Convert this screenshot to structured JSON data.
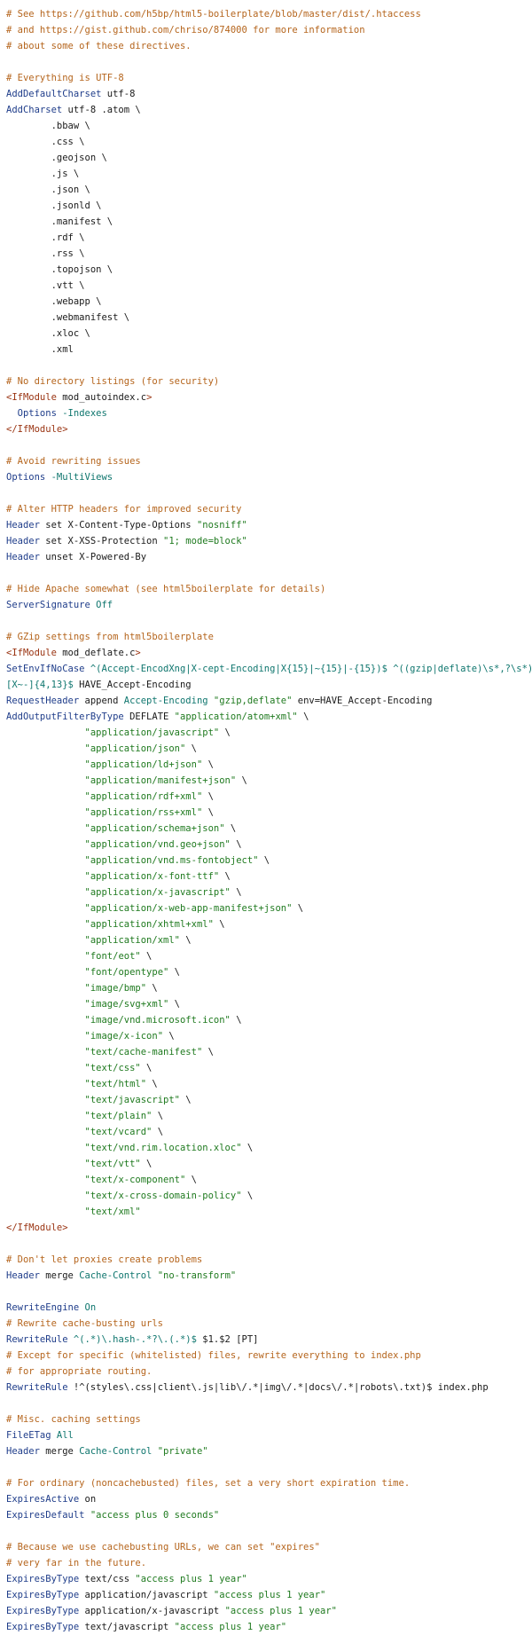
{
  "lines": [
    [
      {
        "t": "comment",
        "s": "# See https://github.com/h5bp/html5-boilerplate/blob/master/dist/.htaccess"
      }
    ],
    [
      {
        "t": "comment",
        "s": "# and https://gist.github.com/chriso/874000 for more information"
      }
    ],
    [
      {
        "t": "comment",
        "s": "# about some of these directives."
      }
    ],
    [],
    [
      {
        "t": "comment",
        "s": "# Everything is UTF-8"
      }
    ],
    [
      {
        "t": "directive",
        "s": "AddDefaultCharset"
      },
      {
        "t": "plain",
        "s": " utf-8"
      }
    ],
    [
      {
        "t": "directive",
        "s": "AddCharset"
      },
      {
        "t": "plain",
        "s": " utf-8 .atom \\"
      }
    ],
    [
      {
        "t": "plain",
        "s": "        .bbaw \\"
      }
    ],
    [
      {
        "t": "plain",
        "s": "        .css \\"
      }
    ],
    [
      {
        "t": "plain",
        "s": "        .geojson \\"
      }
    ],
    [
      {
        "t": "plain",
        "s": "        .js \\"
      }
    ],
    [
      {
        "t": "plain",
        "s": "        .json \\"
      }
    ],
    [
      {
        "t": "plain",
        "s": "        .jsonld \\"
      }
    ],
    [
      {
        "t": "plain",
        "s": "        .manifest \\"
      }
    ],
    [
      {
        "t": "plain",
        "s": "        .rdf \\"
      }
    ],
    [
      {
        "t": "plain",
        "s": "        .rss \\"
      }
    ],
    [
      {
        "t": "plain",
        "s": "        .topojson \\"
      }
    ],
    [
      {
        "t": "plain",
        "s": "        .vtt \\"
      }
    ],
    [
      {
        "t": "plain",
        "s": "        .webapp \\"
      }
    ],
    [
      {
        "t": "plain",
        "s": "        .webmanifest \\"
      }
    ],
    [
      {
        "t": "plain",
        "s": "        .xloc \\"
      }
    ],
    [
      {
        "t": "plain",
        "s": "        .xml"
      }
    ],
    [],
    [
      {
        "t": "comment",
        "s": "# No directory listings (for security)"
      }
    ],
    [
      {
        "t": "tag",
        "s": "<IfModule"
      },
      {
        "t": "plain",
        "s": " mod_autoindex.c"
      },
      {
        "t": "tag",
        "s": ">"
      }
    ],
    [
      {
        "t": "directive",
        "s": "  Options"
      },
      {
        "t": "plain",
        "s": " "
      },
      {
        "t": "value",
        "s": "-Indexes"
      }
    ],
    [
      {
        "t": "tag",
        "s": "</IfModule>"
      }
    ],
    [],
    [
      {
        "t": "comment",
        "s": "# Avoid rewriting issues"
      }
    ],
    [
      {
        "t": "directive",
        "s": "Options"
      },
      {
        "t": "plain",
        "s": " "
      },
      {
        "t": "value",
        "s": "-MultiViews"
      }
    ],
    [],
    [
      {
        "t": "comment",
        "s": "# Alter HTTP headers for improved security"
      }
    ],
    [
      {
        "t": "directive",
        "s": "Header"
      },
      {
        "t": "plain",
        "s": " set X-Content-Type-Options "
      },
      {
        "t": "string",
        "s": "\"nosniff\""
      }
    ],
    [
      {
        "t": "directive",
        "s": "Header"
      },
      {
        "t": "plain",
        "s": " set X-XSS-Protection "
      },
      {
        "t": "string",
        "s": "\"1; mode=block\""
      }
    ],
    [
      {
        "t": "directive",
        "s": "Header"
      },
      {
        "t": "plain",
        "s": " unset X-Powered-By"
      }
    ],
    [],
    [
      {
        "t": "comment",
        "s": "# Hide Apache somewhat (see html5boilerplate for details)"
      }
    ],
    [
      {
        "t": "directive",
        "s": "ServerSignature"
      },
      {
        "t": "plain",
        "s": " "
      },
      {
        "t": "value",
        "s": "Off"
      }
    ],
    [],
    [
      {
        "t": "comment",
        "s": "# GZip settings from html5boilerplate"
      }
    ],
    [
      {
        "t": "tag",
        "s": "<IfModule"
      },
      {
        "t": "plain",
        "s": " mod_deflate.c"
      },
      {
        "t": "tag",
        "s": ">"
      }
    ],
    [
      {
        "t": "directive",
        "s": "SetEnvIfNoCase"
      },
      {
        "t": "plain",
        "s": " "
      },
      {
        "t": "value",
        "s": "^(Accept-EncodXng|X-cept-Encoding|X{15}|~{15}|-{15})$"
      },
      {
        "t": "plain",
        "s": " "
      },
      {
        "t": "value",
        "s": "^((gzip|deflate)\\s*,?\\s*)+|"
      }
    ],
    [
      {
        "t": "value",
        "s": "[X~-]{4,13}$"
      },
      {
        "t": "plain",
        "s": " HAVE_Accept-Encoding"
      }
    ],
    [
      {
        "t": "directive",
        "s": "RequestHeader"
      },
      {
        "t": "plain",
        "s": " append "
      },
      {
        "t": "value",
        "s": "Accept-Encoding"
      },
      {
        "t": "plain",
        "s": " "
      },
      {
        "t": "string",
        "s": "\"gzip,deflate\""
      },
      {
        "t": "plain",
        "s": " env=HAVE_Accept-Encoding"
      }
    ],
    [
      {
        "t": "directive",
        "s": "AddOutputFilterByType"
      },
      {
        "t": "plain",
        "s": " DEFLATE "
      },
      {
        "t": "string",
        "s": "\"application/atom+xml\""
      },
      {
        "t": "plain",
        "s": " \\"
      }
    ],
    [
      {
        "t": "plain",
        "s": "              "
      },
      {
        "t": "string",
        "s": "\"application/javascript\""
      },
      {
        "t": "plain",
        "s": " \\"
      }
    ],
    [
      {
        "t": "plain",
        "s": "              "
      },
      {
        "t": "string",
        "s": "\"application/json\""
      },
      {
        "t": "plain",
        "s": " \\"
      }
    ],
    [
      {
        "t": "plain",
        "s": "              "
      },
      {
        "t": "string",
        "s": "\"application/ld+json\""
      },
      {
        "t": "plain",
        "s": " \\"
      }
    ],
    [
      {
        "t": "plain",
        "s": "              "
      },
      {
        "t": "string",
        "s": "\"application/manifest+json\""
      },
      {
        "t": "plain",
        "s": " \\"
      }
    ],
    [
      {
        "t": "plain",
        "s": "              "
      },
      {
        "t": "string",
        "s": "\"application/rdf+xml\""
      },
      {
        "t": "plain",
        "s": " \\"
      }
    ],
    [
      {
        "t": "plain",
        "s": "              "
      },
      {
        "t": "string",
        "s": "\"application/rss+xml\""
      },
      {
        "t": "plain",
        "s": " \\"
      }
    ],
    [
      {
        "t": "plain",
        "s": "              "
      },
      {
        "t": "string",
        "s": "\"application/schema+json\""
      },
      {
        "t": "plain",
        "s": " \\"
      }
    ],
    [
      {
        "t": "plain",
        "s": "              "
      },
      {
        "t": "string",
        "s": "\"application/vnd.geo+json\""
      },
      {
        "t": "plain",
        "s": " \\"
      }
    ],
    [
      {
        "t": "plain",
        "s": "              "
      },
      {
        "t": "string",
        "s": "\"application/vnd.ms-fontobject\""
      },
      {
        "t": "plain",
        "s": " \\"
      }
    ],
    [
      {
        "t": "plain",
        "s": "              "
      },
      {
        "t": "string",
        "s": "\"application/x-font-ttf\""
      },
      {
        "t": "plain",
        "s": " \\"
      }
    ],
    [
      {
        "t": "plain",
        "s": "              "
      },
      {
        "t": "string",
        "s": "\"application/x-javascript\""
      },
      {
        "t": "plain",
        "s": " \\"
      }
    ],
    [
      {
        "t": "plain",
        "s": "              "
      },
      {
        "t": "string",
        "s": "\"application/x-web-app-manifest+json\""
      },
      {
        "t": "plain",
        "s": " \\"
      }
    ],
    [
      {
        "t": "plain",
        "s": "              "
      },
      {
        "t": "string",
        "s": "\"application/xhtml+xml\""
      },
      {
        "t": "plain",
        "s": " \\"
      }
    ],
    [
      {
        "t": "plain",
        "s": "              "
      },
      {
        "t": "string",
        "s": "\"application/xml\""
      },
      {
        "t": "plain",
        "s": " \\"
      }
    ],
    [
      {
        "t": "plain",
        "s": "              "
      },
      {
        "t": "string",
        "s": "\"font/eot\""
      },
      {
        "t": "plain",
        "s": " \\"
      }
    ],
    [
      {
        "t": "plain",
        "s": "              "
      },
      {
        "t": "string",
        "s": "\"font/opentype\""
      },
      {
        "t": "plain",
        "s": " \\"
      }
    ],
    [
      {
        "t": "plain",
        "s": "              "
      },
      {
        "t": "string",
        "s": "\"image/bmp\""
      },
      {
        "t": "plain",
        "s": " \\"
      }
    ],
    [
      {
        "t": "plain",
        "s": "              "
      },
      {
        "t": "string",
        "s": "\"image/svg+xml\""
      },
      {
        "t": "plain",
        "s": " \\"
      }
    ],
    [
      {
        "t": "plain",
        "s": "              "
      },
      {
        "t": "string",
        "s": "\"image/vnd.microsoft.icon\""
      },
      {
        "t": "plain",
        "s": " \\"
      }
    ],
    [
      {
        "t": "plain",
        "s": "              "
      },
      {
        "t": "string",
        "s": "\"image/x-icon\""
      },
      {
        "t": "plain",
        "s": " \\"
      }
    ],
    [
      {
        "t": "plain",
        "s": "              "
      },
      {
        "t": "string",
        "s": "\"text/cache-manifest\""
      },
      {
        "t": "plain",
        "s": " \\"
      }
    ],
    [
      {
        "t": "plain",
        "s": "              "
      },
      {
        "t": "string",
        "s": "\"text/css\""
      },
      {
        "t": "plain",
        "s": " \\"
      }
    ],
    [
      {
        "t": "plain",
        "s": "              "
      },
      {
        "t": "string",
        "s": "\"text/html\""
      },
      {
        "t": "plain",
        "s": " \\"
      }
    ],
    [
      {
        "t": "plain",
        "s": "              "
      },
      {
        "t": "string",
        "s": "\"text/javascript\""
      },
      {
        "t": "plain",
        "s": " \\"
      }
    ],
    [
      {
        "t": "plain",
        "s": "              "
      },
      {
        "t": "string",
        "s": "\"text/plain\""
      },
      {
        "t": "plain",
        "s": " \\"
      }
    ],
    [
      {
        "t": "plain",
        "s": "              "
      },
      {
        "t": "string",
        "s": "\"text/vcard\""
      },
      {
        "t": "plain",
        "s": " \\"
      }
    ],
    [
      {
        "t": "plain",
        "s": "              "
      },
      {
        "t": "string",
        "s": "\"text/vnd.rim.location.xloc\""
      },
      {
        "t": "plain",
        "s": " \\"
      }
    ],
    [
      {
        "t": "plain",
        "s": "              "
      },
      {
        "t": "string",
        "s": "\"text/vtt\""
      },
      {
        "t": "plain",
        "s": " \\"
      }
    ],
    [
      {
        "t": "plain",
        "s": "              "
      },
      {
        "t": "string",
        "s": "\"text/x-component\""
      },
      {
        "t": "plain",
        "s": " \\"
      }
    ],
    [
      {
        "t": "plain",
        "s": "              "
      },
      {
        "t": "string",
        "s": "\"text/x-cross-domain-policy\""
      },
      {
        "t": "plain",
        "s": " \\"
      }
    ],
    [
      {
        "t": "plain",
        "s": "              "
      },
      {
        "t": "string",
        "s": "\"text/xml\""
      }
    ],
    [
      {
        "t": "tag",
        "s": "</IfModule>"
      }
    ],
    [],
    [
      {
        "t": "comment",
        "s": "# Don't let proxies create problems"
      }
    ],
    [
      {
        "t": "directive",
        "s": "Header"
      },
      {
        "t": "plain",
        "s": " merge "
      },
      {
        "t": "value",
        "s": "Cache-Control"
      },
      {
        "t": "plain",
        "s": " "
      },
      {
        "t": "string",
        "s": "\"no-transform\""
      }
    ],
    [],
    [
      {
        "t": "directive",
        "s": "RewriteEngine"
      },
      {
        "t": "plain",
        "s": " "
      },
      {
        "t": "value",
        "s": "On"
      }
    ],
    [
      {
        "t": "comment",
        "s": "# Rewrite cache-busting urls"
      }
    ],
    [
      {
        "t": "directive",
        "s": "RewriteRule"
      },
      {
        "t": "plain",
        "s": " "
      },
      {
        "t": "value",
        "s": "^(.*)\\.hash-.*?\\.(.*)$"
      },
      {
        "t": "plain",
        "s": " $1.$2 [PT]"
      }
    ],
    [
      {
        "t": "comment",
        "s": "# Except for specific (whitelisted) files, rewrite everything to index.php"
      }
    ],
    [
      {
        "t": "comment",
        "s": "# for appropriate routing."
      }
    ],
    [
      {
        "t": "directive",
        "s": "RewriteRule"
      },
      {
        "t": "plain",
        "s": " !^(styles\\.css|client\\.js|lib\\/.*|img\\/.*|docs\\/.*|robots\\.txt)$ index.php"
      }
    ],
    [],
    [
      {
        "t": "comment",
        "s": "# Misc. caching settings"
      }
    ],
    [
      {
        "t": "directive",
        "s": "FileETag"
      },
      {
        "t": "plain",
        "s": " "
      },
      {
        "t": "value",
        "s": "All"
      }
    ],
    [
      {
        "t": "directive",
        "s": "Header"
      },
      {
        "t": "plain",
        "s": " merge "
      },
      {
        "t": "value",
        "s": "Cache-Control"
      },
      {
        "t": "plain",
        "s": " "
      },
      {
        "t": "string",
        "s": "\"private\""
      }
    ],
    [],
    [
      {
        "t": "comment",
        "s": "# For ordinary (noncachebusted) files, set a very short expiration time."
      }
    ],
    [
      {
        "t": "directive",
        "s": "ExpiresActive"
      },
      {
        "t": "plain",
        "s": " on"
      }
    ],
    [
      {
        "t": "directive",
        "s": "ExpiresDefault"
      },
      {
        "t": "plain",
        "s": " "
      },
      {
        "t": "string",
        "s": "\"access plus 0 seconds\""
      }
    ],
    [],
    [
      {
        "t": "comment",
        "s": "# Because we use cachebusting URLs, we can set \"expires\""
      }
    ],
    [
      {
        "t": "comment",
        "s": "# very far in the future."
      }
    ],
    [
      {
        "t": "directive",
        "s": "ExpiresByType"
      },
      {
        "t": "plain",
        "s": " text/css "
      },
      {
        "t": "string",
        "s": "\"access plus 1 year\""
      }
    ],
    [
      {
        "t": "directive",
        "s": "ExpiresByType"
      },
      {
        "t": "plain",
        "s": " application/javascript "
      },
      {
        "t": "string",
        "s": "\"access plus 1 year\""
      }
    ],
    [
      {
        "t": "directive",
        "s": "ExpiresByType"
      },
      {
        "t": "plain",
        "s": " application/x-javascript "
      },
      {
        "t": "string",
        "s": "\"access plus 1 year\""
      }
    ],
    [
      {
        "t": "directive",
        "s": "ExpiresByType"
      },
      {
        "t": "plain",
        "s": " text/javascript "
      },
      {
        "t": "string",
        "s": "\"access plus 1 year\""
      }
    ]
  ],
  "colors": {
    "comment": "#b5651d",
    "directive": "#1f3d8a",
    "tag": "#9a3412",
    "string": "#1f7a1f",
    "value": "#0f766e",
    "plain": "#1a1a1a",
    "background": "#ffffff"
  }
}
